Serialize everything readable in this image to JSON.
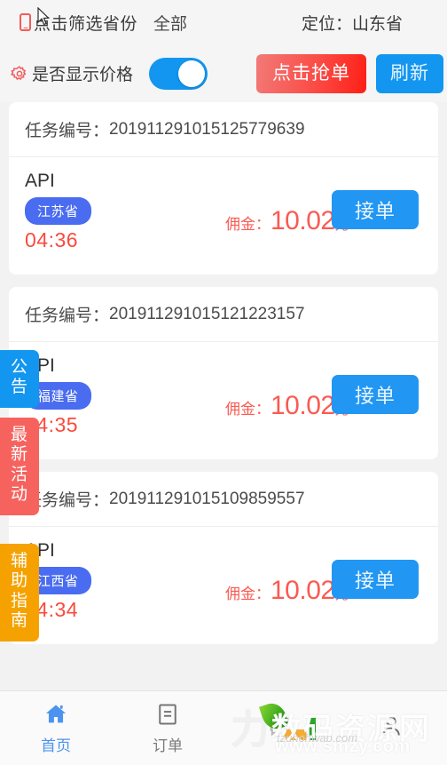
{
  "header": {
    "phone_icon": "mobile-icon",
    "filter_label": "点击筛选省份",
    "filter_value": "全部",
    "location_text": "定位：山东省",
    "gear_icon": "gear-icon",
    "price_toggle_label": "是否显示价格",
    "price_toggle_state": "on",
    "grab_button": "点击抢单",
    "refresh_button": "刷新"
  },
  "side_tabs": [
    {
      "name": "notice",
      "lines": [
        "公",
        "告"
      ],
      "color": "#1296f0"
    },
    {
      "name": "activity",
      "lines": [
        "最",
        "新",
        "活",
        "动"
      ],
      "color": "#f6635e"
    },
    {
      "name": "guide",
      "lines": [
        "辅",
        "助",
        "指",
        "南"
      ],
      "color": "#f5a200"
    }
  ],
  "list": {
    "task_no_label": "任务编号：",
    "commission_label": "佣金：",
    "currency_unit": "元",
    "accept_button": "接单",
    "cards": [
      {
        "task_no": "201911291015125779639",
        "type": "API",
        "province": "江苏省",
        "timer": "04:36",
        "commission": "10.02"
      },
      {
        "task_no": "201911291015121223157",
        "type": "API",
        "province": "福建省",
        "timer": "04:35",
        "commission": "10.02"
      },
      {
        "task_no": "201911291015109859557",
        "type": "API",
        "province": "江西省",
        "timer": "04:34",
        "commission": "10.02"
      }
    ]
  },
  "bottom_nav": [
    {
      "name": "home",
      "icon": "home-icon",
      "label": "首页",
      "active": true
    },
    {
      "name": "orders",
      "icon": "document-icon",
      "label": "订单",
      "active": false
    },
    {
      "name": "message",
      "icon": "chat-icon",
      "label": "",
      "active": false
    },
    {
      "name": "profile",
      "icon": "person-icon",
      "label": "",
      "active": false
    }
  ],
  "watermark": {
    "mark": "力",
    "main_text": "数码资源网",
    "sub_text": "www.smzy.com",
    "tiny_text": "tzuhohwap.com"
  },
  "colors": {
    "accent_blue": "#1296f0",
    "badge_blue": "#4a6cf0",
    "danger_red": "#fa4a3d",
    "warn_orange": "#f5a200",
    "page_bg": "#f2f2f2"
  }
}
